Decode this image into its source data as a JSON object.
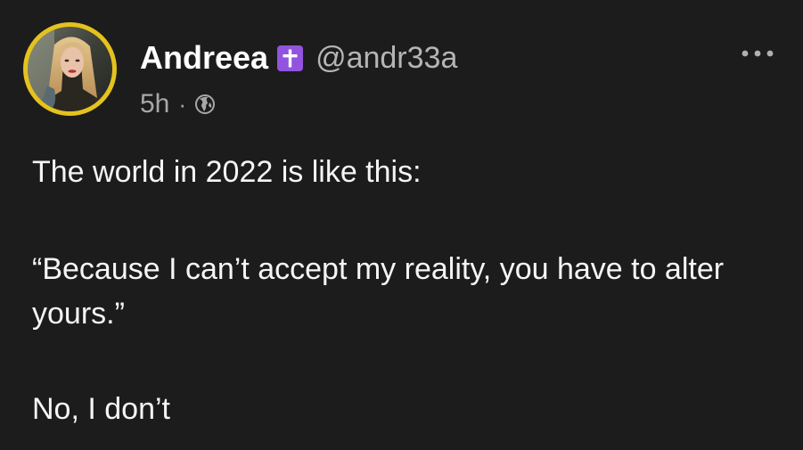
{
  "post": {
    "author": {
      "display_name": "Andreea",
      "handle": "@andr33a",
      "badge_icon": "latin-cross-icon",
      "badge_color": "#9254de",
      "avatar_ring_color": "#e5c21d"
    },
    "timestamp": "5h",
    "meta_separator": "·",
    "audience_icon": "globe-icon",
    "more_icon": "more-options-icon",
    "body": {
      "paragraph_1": "The world in 2022 is like this:",
      "paragraph_2": "“Because I can’t accept my reality, you have to alter yours.”",
      "paragraph_3": "No, I don’t"
    }
  }
}
